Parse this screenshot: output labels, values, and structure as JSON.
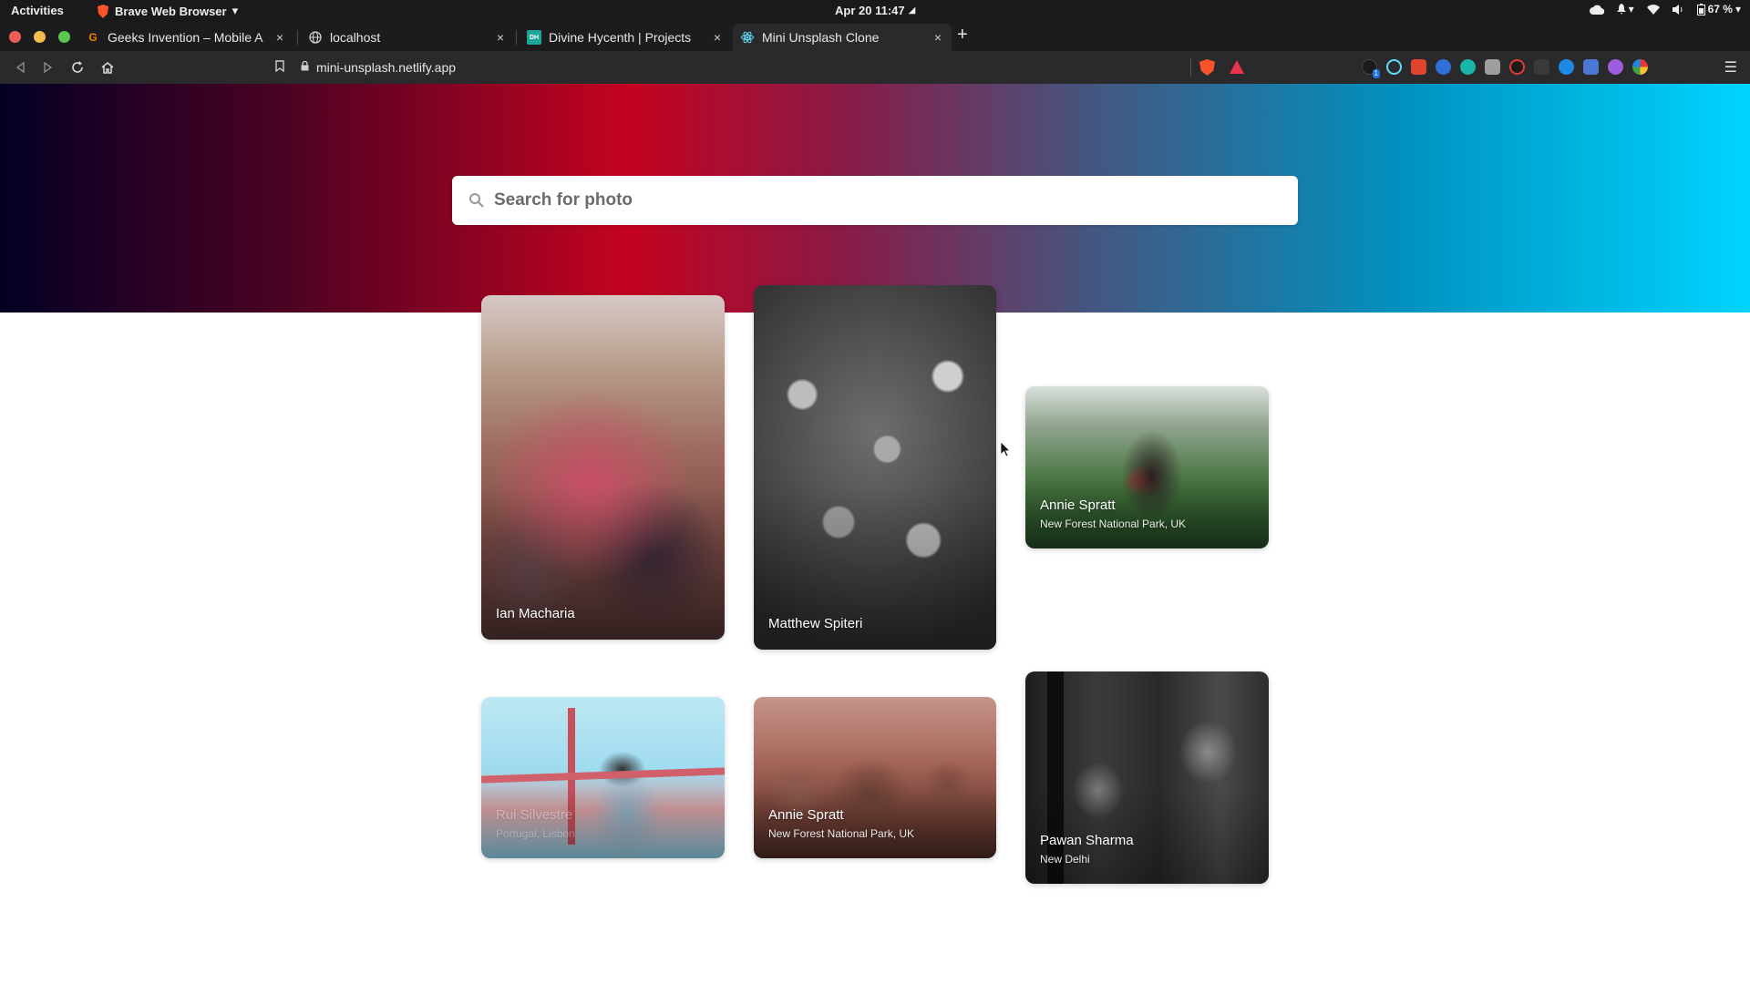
{
  "system_bar": {
    "activities": "Activities",
    "app_name": "Brave Web Browser",
    "clock": "Apr 20  11:47",
    "battery": "67 %"
  },
  "tabs": [
    {
      "title": "Geeks Invention – Mobile A",
      "favicon": "G",
      "favicon_color": "#f57c00",
      "close": "×"
    },
    {
      "title": "localhost",
      "favicon": "globe-icon",
      "close": "×"
    },
    {
      "title": "Divine Hycenth | Projects",
      "favicon": "DH",
      "favicon_color": "#1ea59a",
      "close": "×"
    },
    {
      "title": "Mini Unsplash Clone",
      "favicon": "react-icon",
      "favicon_color": "#61dafb",
      "close": "×",
      "active": true
    }
  ],
  "new_tab": "+",
  "address_bar": {
    "url": "mini-unsplash.netlify.app"
  },
  "search": {
    "placeholder": "Search for photo",
    "value": ""
  },
  "photos": [
    {
      "name": "Ian Macharia",
      "location": ""
    },
    {
      "name": "Matthew Spiteri",
      "location": ""
    },
    {
      "name": "Annie Spratt",
      "location": "New Forest National Park, UK"
    },
    {
      "name": "Rui Silvestre",
      "location": "Portugal, Lisbon"
    },
    {
      "name": "Annie Spratt",
      "location": "New Forest National Park, UK"
    },
    {
      "name": "Pawan Sharma",
      "location": "New Delhi"
    }
  ],
  "colors": {
    "hero_gradient": [
      "#020024",
      "#c40320",
      "#00d4ff"
    ],
    "tab_bg": "#1c1c1e",
    "toolbar_bg": "#2a2a2c"
  }
}
